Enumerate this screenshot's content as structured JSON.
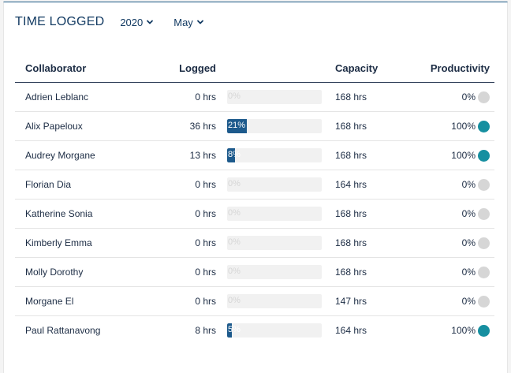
{
  "header": {
    "title": "TIME LOGGED",
    "year": "2020",
    "month": "May"
  },
  "table": {
    "columns": {
      "collaborator": "Collaborator",
      "logged": "Logged",
      "capacity": "Capacity",
      "productivity": "Productivity"
    },
    "rows": [
      {
        "name": "Adrien Leblanc",
        "logged": "0 hrs",
        "bar_label": "0%",
        "bar_pct": 0,
        "capacity": "168 hrs",
        "productivity": "0%",
        "dot": "gray"
      },
      {
        "name": "Alix Papeloux",
        "logged": "36 hrs",
        "bar_label": "21%",
        "bar_pct": 21,
        "capacity": "168 hrs",
        "productivity": "100%",
        "dot": "teal"
      },
      {
        "name": "Audrey Morgane",
        "logged": "13 hrs",
        "bar_label": "8%",
        "bar_pct": 8,
        "capacity": "168 hrs",
        "productivity": "100%",
        "dot": "teal"
      },
      {
        "name": "Florian Dia",
        "logged": "0 hrs",
        "bar_label": "0%",
        "bar_pct": 0,
        "capacity": "164 hrs",
        "productivity": "0%",
        "dot": "gray"
      },
      {
        "name": "Katherine Sonia",
        "logged": "0 hrs",
        "bar_label": "0%",
        "bar_pct": 0,
        "capacity": "168 hrs",
        "productivity": "0%",
        "dot": "gray"
      },
      {
        "name": "Kimberly Emma",
        "logged": "0 hrs",
        "bar_label": "0%",
        "bar_pct": 0,
        "capacity": "168 hrs",
        "productivity": "0%",
        "dot": "gray"
      },
      {
        "name": "Molly Dorothy",
        "logged": "0 hrs",
        "bar_label": "0%",
        "bar_pct": 0,
        "capacity": "168 hrs",
        "productivity": "0%",
        "dot": "gray"
      },
      {
        "name": "Morgane El",
        "logged": "0 hrs",
        "bar_label": "0%",
        "bar_pct": 0,
        "capacity": "147 hrs",
        "productivity": "0%",
        "dot": "gray"
      },
      {
        "name": "Paul Rattanavong",
        "logged": "8 hrs",
        "bar_label": "5%",
        "bar_pct": 5,
        "capacity": "164 hrs",
        "productivity": "100%",
        "dot": "teal"
      }
    ]
  },
  "colors": {
    "accent": "#1d5a8c",
    "teal": "#168fa0",
    "gray": "#d6d6d6"
  }
}
